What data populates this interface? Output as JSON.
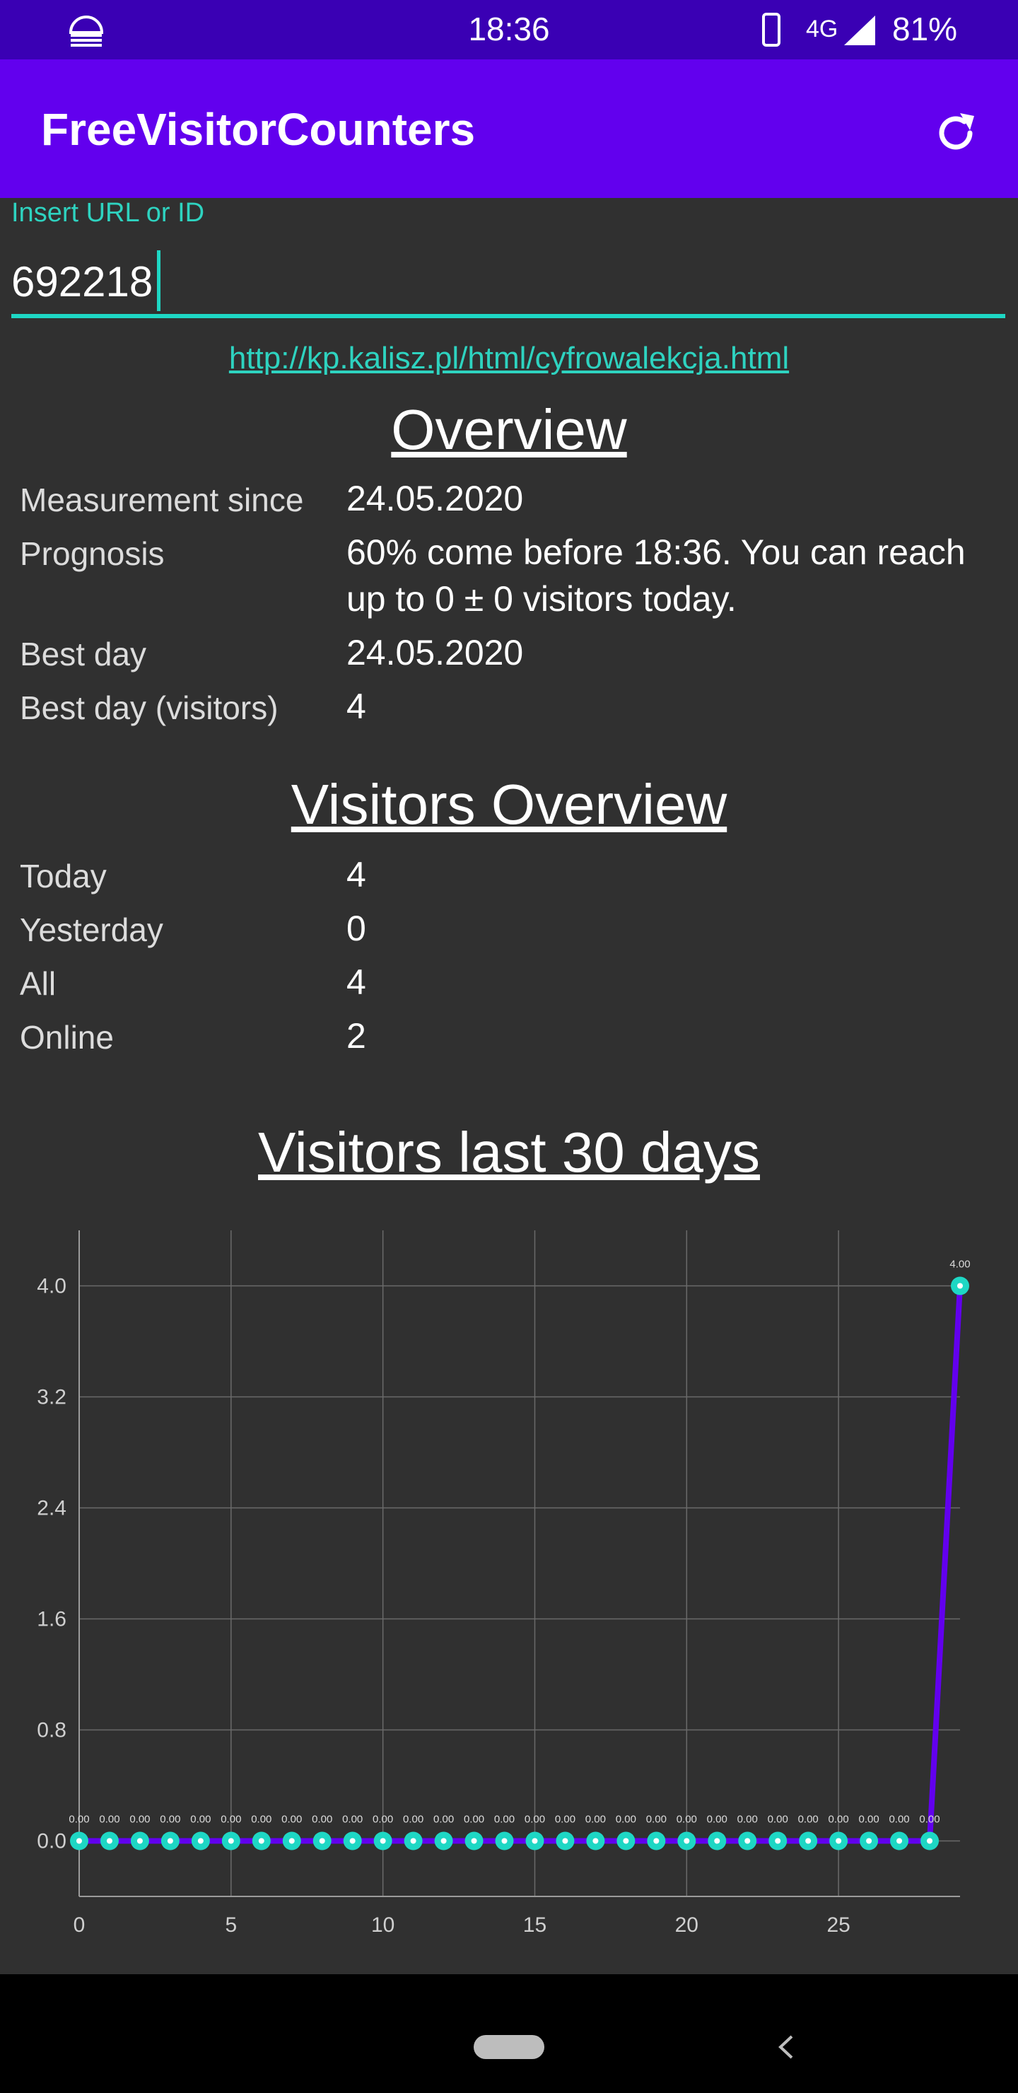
{
  "status_bar": {
    "time": "18:36",
    "network": "4G",
    "battery": "81%",
    "icons": [
      "hamburger-icon",
      "phone-icon",
      "signal-icon"
    ]
  },
  "app_bar": {
    "title": "FreeVisitorCounters",
    "refresh_icon": "refresh-icon"
  },
  "input": {
    "label": "Insert URL or ID",
    "value": "692218"
  },
  "url": "http://kp.kalisz.pl/html/cyfrowalekcja.html",
  "overview": {
    "title": "Overview",
    "rows": [
      {
        "label": "Measurement since",
        "value": "24.05.2020"
      },
      {
        "label": "Prognosis",
        "value": "60% come before 18:36. You can reach up to 0 ± 0 visitors today."
      },
      {
        "label": "Best day",
        "value": "24.05.2020"
      },
      {
        "label": "Best day (visitors)",
        "value": "4"
      }
    ]
  },
  "visitors_overview": {
    "title": "Visitors Overview",
    "rows": [
      {
        "label": "Today",
        "value": "4"
      },
      {
        "label": "Yesterday",
        "value": "0"
      },
      {
        "label": "All",
        "value": "4"
      },
      {
        "label": "Online",
        "value": "2"
      }
    ]
  },
  "chart_title": "Visitors last 30 days",
  "chart_data": {
    "type": "line",
    "x": [
      0,
      1,
      2,
      3,
      4,
      5,
      6,
      7,
      8,
      9,
      10,
      11,
      12,
      13,
      14,
      15,
      16,
      17,
      18,
      19,
      20,
      21,
      22,
      23,
      24,
      25,
      26,
      27,
      28,
      29
    ],
    "series": [
      {
        "values": [
          0,
          0,
          0,
          0,
          0,
          0,
          0,
          0,
          0,
          0,
          0,
          0,
          0,
          0,
          0,
          0,
          0,
          0,
          0,
          0,
          0,
          0,
          0,
          0,
          0,
          0,
          0,
          0,
          0,
          4
        ]
      }
    ],
    "data_labels": [
      "0.00",
      "0.00",
      "0.00",
      "0.00",
      "0.00",
      "0.00",
      "0.00",
      "0.00",
      "0.00",
      "0.00",
      "0.00",
      "0.00",
      "0.00",
      "0.00",
      "0.00",
      "0.00",
      "0.00",
      "0.00",
      "0.00",
      "0.00",
      "0.00",
      "0.00",
      "0.00",
      "0.00",
      "0.00",
      "0.00",
      "0.00",
      "0.00",
      "0.00",
      "4.00"
    ],
    "x_ticks": [
      "0",
      "5",
      "10",
      "15",
      "20",
      "25"
    ],
    "x_tick_values": [
      0,
      5,
      10,
      15,
      20,
      25
    ],
    "y_ticks": [
      "0.0",
      "0.8",
      "1.6",
      "2.4",
      "3.2",
      "4.0"
    ],
    "y_tick_values": [
      0,
      0.8,
      1.6,
      2.4,
      3.2,
      4.0
    ],
    "xlim": [
      0,
      29
    ],
    "ylim": [
      -0.4,
      4.4
    ],
    "grid": true,
    "line_color": "#6200ee",
    "point_color": "#1ed7c4"
  }
}
